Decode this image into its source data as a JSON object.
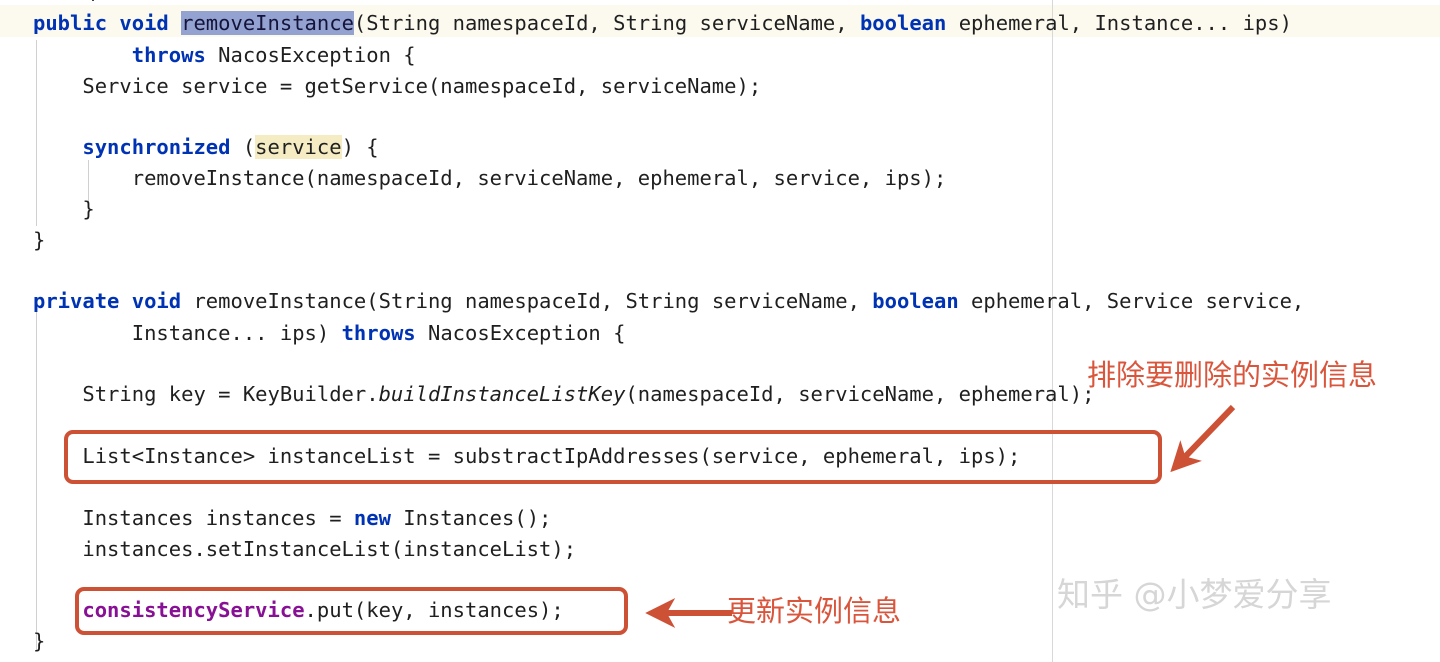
{
  "editor": {
    "background_color": "#ffffff",
    "caret_row_color": "#fcfaef",
    "selection_color": "#93a2d1",
    "occurrence_color": "#f5ecc4",
    "keyword_color": "#0033b3",
    "field_color": "#871094",
    "text_color": "#1f1f1f",
    "guide_color": "#d0d0d0",
    "margin_guide_column_x": 1052,
    "top_clipped_line": ";",
    "code_lines": [
      {
        "id": "l01",
        "text": "public void removeInstance(String namespaceId, String serviceName, boolean ephemeral, Instance... ips)"
      },
      {
        "id": "l02",
        "text": "        throws NacosException {"
      },
      {
        "id": "l03",
        "text": "    Service service = getService(namespaceId, serviceName);"
      },
      {
        "id": "l04",
        "text": ""
      },
      {
        "id": "l05",
        "text": "    synchronized (service) {"
      },
      {
        "id": "l06",
        "text": "        removeInstance(namespaceId, serviceName, ephemeral, service, ips);"
      },
      {
        "id": "l07",
        "text": "    }"
      },
      {
        "id": "l08",
        "text": "}"
      },
      {
        "id": "l09",
        "text": ""
      },
      {
        "id": "l10",
        "text": "private void removeInstance(String namespaceId, String serviceName, boolean ephemeral, Service service,"
      },
      {
        "id": "l11",
        "text": "        Instance... ips) throws NacosException {"
      },
      {
        "id": "l12",
        "text": ""
      },
      {
        "id": "l13",
        "text": "    String key = KeyBuilder.buildInstanceListKey(namespaceId, serviceName, ephemeral);"
      },
      {
        "id": "l14",
        "text": ""
      },
      {
        "id": "l15",
        "text": "    List<Instance> instanceList = substractIpAddresses(service, ephemeral, ips);"
      },
      {
        "id": "l16",
        "text": ""
      },
      {
        "id": "l17",
        "text": "    Instances instances = new Instances();"
      },
      {
        "id": "l18",
        "text": "    instances.setInstanceList(instanceList);"
      },
      {
        "id": "l19",
        "text": ""
      },
      {
        "id": "l20",
        "text": "    consistencyService.put(key, instances);"
      },
      {
        "id": "l21",
        "text": "}"
      }
    ],
    "tokens": {
      "public": "public",
      "void": "void",
      "private": "private",
      "boolean": "boolean",
      "throws": "throws",
      "synchronized": "synchronized",
      "new": "new",
      "selected_identifier": "removeInstance",
      "highlighted_occurrence": "service",
      "static_method": "buildInstanceListKey",
      "field_identifier": "consistencyService"
    }
  },
  "annotations": {
    "accent_color": "#d9563c",
    "box_color": "#cd5135",
    "items": [
      {
        "id": "a1",
        "label": "排除要删除的实例信息",
        "target_code": "List<Instance> instanceList = substractIpAddresses(service, ephemeral, ips);",
        "arrow_direction": "down-left"
      },
      {
        "id": "a2",
        "label": "更新实例信息",
        "target_code": "consistencyService.put(key, instances);",
        "arrow_direction": "left"
      }
    ]
  },
  "watermark": {
    "text": "知乎 @小梦爱分享",
    "color": "#d6d6d6"
  }
}
